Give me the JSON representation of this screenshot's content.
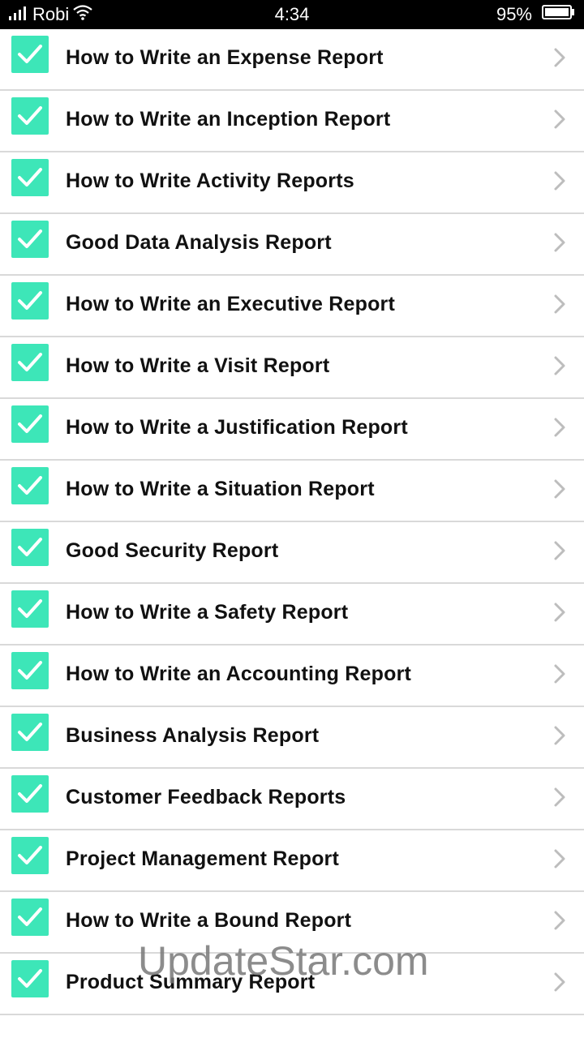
{
  "status_bar": {
    "carrier": "Robi",
    "time": "4:34",
    "battery": "95%"
  },
  "items": [
    {
      "label": "How to Write an Expense Report"
    },
    {
      "label": "How to Write an Inception Report"
    },
    {
      "label": "How to Write Activity Reports"
    },
    {
      "label": "Good Data Analysis Report"
    },
    {
      "label": "How to Write an Executive Report"
    },
    {
      "label": "How to Write a Visit Report"
    },
    {
      "label": "How to Write a Justification Report"
    },
    {
      "label": "How to Write a Situation Report"
    },
    {
      "label": "Good Security Report"
    },
    {
      "label": "How to Write a Safety Report"
    },
    {
      "label": "How to Write an Accounting Report"
    },
    {
      "label": "Business Analysis Report"
    },
    {
      "label": "Customer Feedback Reports"
    },
    {
      "label": "Project Management Report"
    },
    {
      "label": "How to Write a Bound Report"
    },
    {
      "label": "Product Summary Report"
    }
  ],
  "watermark": "UpdateStar.com",
  "colors": {
    "checkbox": "#3de6b8",
    "divider": "#d9d9d9",
    "chevron": "#bdbdbd"
  }
}
